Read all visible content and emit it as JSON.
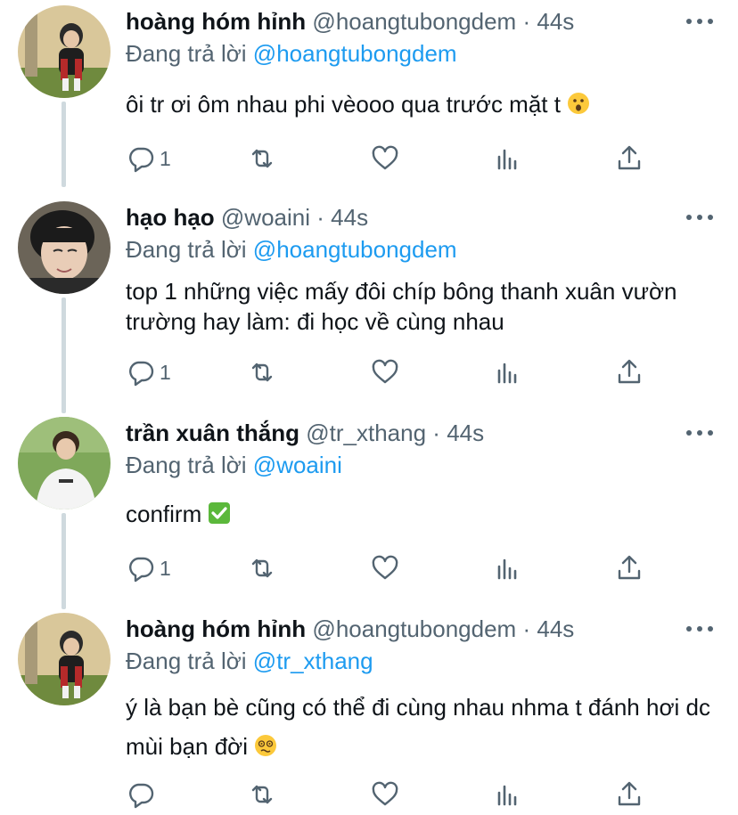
{
  "tweets": [
    {
      "name": "hoàng hóm hỉnh",
      "handle": "@hoangtubongdem",
      "dot": "·",
      "time": "44s",
      "reply_prefix": "Đang trả lời",
      "reply_to": "@hoangtubongdem",
      "text": "ôi tr ơi ôm nhau phi vèooo qua trước mặt t",
      "emoji": "hushed-face",
      "reply_count": "1"
    },
    {
      "name": "hạo hạo",
      "handle": "@woaini",
      "dot": "·",
      "time": "44s",
      "reply_prefix": "Đang trả lời",
      "reply_to": "@hoangtubongdem",
      "text": "top 1 những việc mấy đôi chíp bông thanh xuân vườn trường hay làm: đi học về cùng nhau",
      "reply_count": "1"
    },
    {
      "name": "trần xuân thắng",
      "handle": "@tr_xthang",
      "dot": "·",
      "time": "44s",
      "reply_prefix": "Đang trả lời",
      "reply_to": "@woaini",
      "text": "confirm",
      "emoji": "check-mark-button",
      "reply_count": "1"
    },
    {
      "name": "hoàng hóm hỉnh",
      "handle": "@hoangtubongdem",
      "dot": "·",
      "time": "44s",
      "reply_prefix": "Đang trả lời",
      "reply_to": "@tr_xthang",
      "text": "ý là bạn bè cũng có thể đi cùng nhau nhma t đánh hơi dc mùi bạn đời",
      "emoji": "woozy-face",
      "reply_count": ""
    }
  ],
  "icons": {
    "reply": "reply-icon",
    "retweet": "retweet-icon",
    "like": "heart-icon",
    "analytics": "analytics-icon",
    "share": "share-icon",
    "more": "more-icon"
  },
  "colors": {
    "text": "#0f1419",
    "secondary": "#536471",
    "link": "#1d9bf0",
    "thread_line": "#cfd9de"
  }
}
